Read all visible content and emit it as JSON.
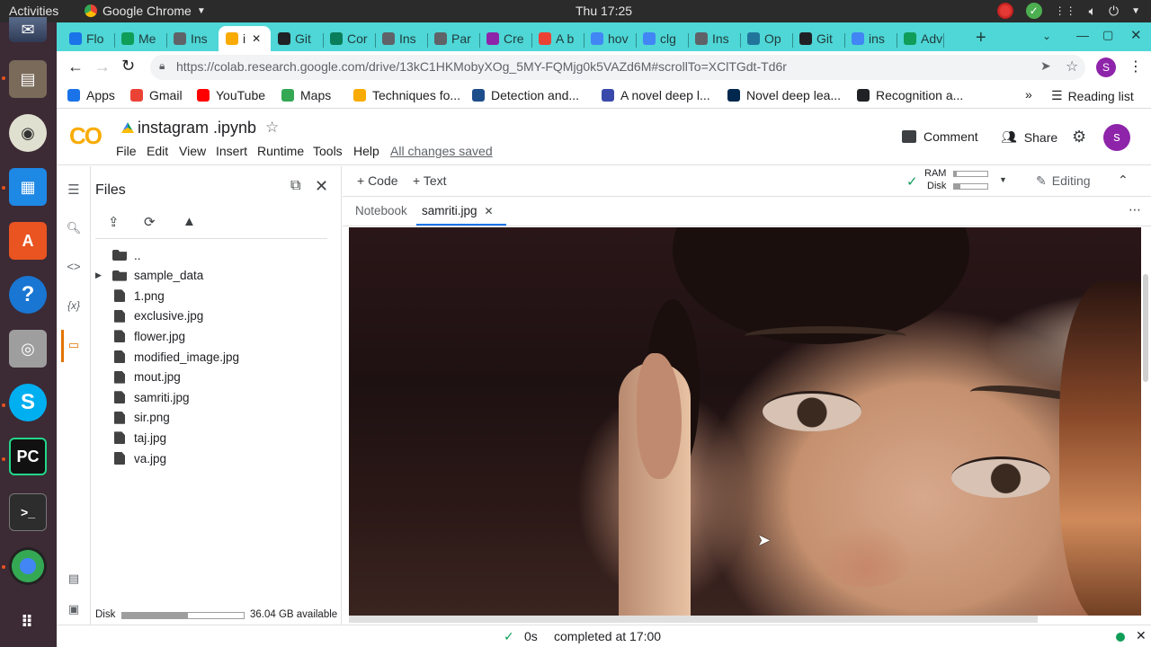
{
  "os": {
    "activities": "Activities",
    "app_name": "Google Chrome",
    "clock": "Thu 17:25"
  },
  "browser": {
    "tabs": [
      {
        "label": "Flo",
        "icon": "flow-icon",
        "color": "#1a73e8"
      },
      {
        "label": "Me",
        "icon": "sheets-icon",
        "color": "#0f9d58"
      },
      {
        "label": "Ins",
        "icon": "globe-icon",
        "color": "#5f6368"
      },
      {
        "label": "i",
        "icon": "colab-icon",
        "color": "#f9ab00",
        "active": true
      },
      {
        "label": "Git",
        "icon": "github-icon",
        "color": "#202124"
      },
      {
        "label": "Cor",
        "icon": "chevron-icon",
        "color": "#0a7d5a"
      },
      {
        "label": "Ins",
        "icon": "globe-icon",
        "color": "#5f6368"
      },
      {
        "label": "Par",
        "icon": "pen-icon",
        "color": "#5f6368"
      },
      {
        "label": "Cre",
        "icon": "cre-icon",
        "color": "#8e24aa"
      },
      {
        "label": "A b",
        "icon": "chrome-icon",
        "color": "#ea4335"
      },
      {
        "label": "hov",
        "icon": "google-icon",
        "color": "#4285f4"
      },
      {
        "label": "clg",
        "icon": "google-icon",
        "color": "#4285f4"
      },
      {
        "label": "Ins",
        "icon": "globe-icon",
        "color": "#5f6368"
      },
      {
        "label": "Op",
        "icon": "wordpress-icon",
        "color": "#21759b"
      },
      {
        "label": "Git",
        "icon": "github-icon",
        "color": "#202124"
      },
      {
        "label": "ins",
        "icon": "google-icon",
        "color": "#4285f4"
      },
      {
        "label": "Adv",
        "icon": "adv-icon",
        "color": "#0f9d58"
      }
    ],
    "url": "https://colab.research.google.com/drive/13kC1HKMobyXOg_5MY-FQMjg0k5VAZd6M#scrollTo=XClTGdt-Td6r",
    "profile_initial": "S",
    "bookmarks": [
      {
        "label": "Apps",
        "icon": "apps-grid-icon",
        "color": "#1a73e8"
      },
      {
        "label": "Gmail",
        "icon": "gmail-icon",
        "color": "#ea4335"
      },
      {
        "label": "YouTube",
        "icon": "youtube-icon",
        "color": "#ff0000"
      },
      {
        "label": "Maps",
        "icon": "maps-icon",
        "color": "#34a853"
      },
      {
        "label": "Techniques fo...",
        "icon": "techniques-icon",
        "color": "#f9ab00"
      },
      {
        "label": "Detection and...",
        "icon": "ios-icon",
        "color": "#1e4d8c"
      },
      {
        "label": "A novel deep l...",
        "icon": "diamond-icon",
        "color": "#3949ab"
      },
      {
        "label": "Novel deep lea...",
        "icon": "ieee-icon",
        "color": "#00274d"
      },
      {
        "label": "Recognition a...",
        "icon": "rg-icon",
        "color": "#202124"
      }
    ],
    "reading_list": "Reading list"
  },
  "colab": {
    "logo": "CO",
    "notebook_title": "instagram .ipynb",
    "menu": [
      "File",
      "Edit",
      "View",
      "Insert",
      "Runtime",
      "Tools",
      "Help"
    ],
    "save_status": "All changes saved",
    "comment": "Comment",
    "share": "Share",
    "avatar_initial": "s",
    "add_code": "+ Code",
    "add_text": "+ Text",
    "ram_label": "RAM",
    "disk_label": "Disk",
    "ram_fraction": 0.08,
    "disk_fraction": 0.18,
    "editing": "Editing",
    "files_title": "Files",
    "files": [
      {
        "name": "..",
        "type": "up"
      },
      {
        "name": "sample_data",
        "type": "folder"
      },
      {
        "name": "1.png",
        "type": "file"
      },
      {
        "name": "exclusive.jpg",
        "type": "file"
      },
      {
        "name": "flower.jpg",
        "type": "file"
      },
      {
        "name": "modified_image.jpg",
        "type": "file"
      },
      {
        "name": "mout.jpg",
        "type": "file"
      },
      {
        "name": "samriti.jpg",
        "type": "file"
      },
      {
        "name": "sir.png",
        "type": "file"
      },
      {
        "name": "taj.jpg",
        "type": "file"
      },
      {
        "name": "va.jpg",
        "type": "file"
      }
    ],
    "disk_footer_label": "Disk",
    "disk_footer_fraction": 0.54,
    "disk_available": "36.04 GB available",
    "viewer_tabs": [
      {
        "label": "Notebook"
      },
      {
        "label": "samriti.jpg",
        "active": true
      }
    ],
    "status_time": "0s",
    "status_text": "completed at 17:00",
    "colors": {
      "accent": "#e37400",
      "brand_orange": "#f9ab00",
      "avatar": "#8e24aa",
      "ok_green": "#0f9d58"
    }
  }
}
